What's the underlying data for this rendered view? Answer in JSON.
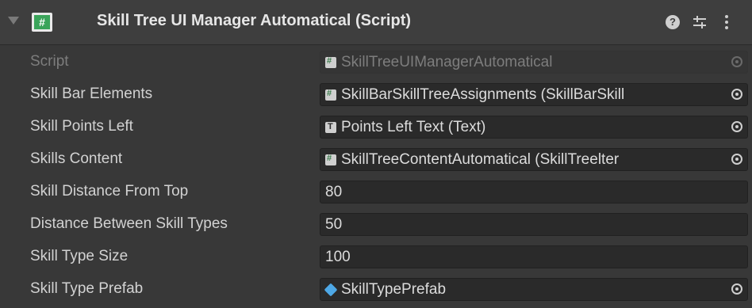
{
  "component": {
    "title": "Skill Tree UI Manager Automatical (Script)",
    "fold_icon": "triangle-down-icon",
    "script_icon": "cs-script-icon",
    "header_icons": [
      "help-icon",
      "presets-icon",
      "menu-dots-icon"
    ]
  },
  "fields": [
    {
      "label": "Script",
      "value": "SkillTreeUIManagerAutomatical",
      "icon": "cs-script-icon",
      "disabled": true
    },
    {
      "label": "Skill Bar Elements",
      "value": "SkillBarSkillTreeAssignments (SkillBarSkill",
      "icon": "cs-script-icon"
    },
    {
      "label": "Skill Points Left",
      "value": "Points Left Text (Text)",
      "icon": "text-component-icon"
    },
    {
      "label": "Skills Content",
      "value": "SkillTreeContentAutomatical (SkillTreelter",
      "icon": "cs-script-icon"
    },
    {
      "label": "Skill Distance From Top",
      "value": "80"
    },
    {
      "label": "Distance Between Skill Types",
      "value": "50"
    },
    {
      "label": "Skill Type Size",
      "value": "100"
    },
    {
      "label": "Skill Type Prefab",
      "value": "SkillTypePrefab",
      "icon": "prefab-icon"
    }
  ],
  "colors": {
    "background": "#383838",
    "header": "#3e3e3e",
    "field": "#2a2a2a",
    "script_icon_green": "#3aa45a",
    "prefab_blue": "#4ea8e6"
  }
}
